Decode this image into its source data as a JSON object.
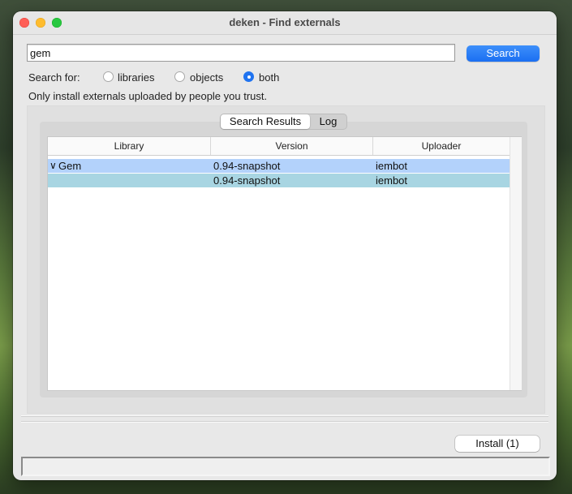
{
  "window": {
    "title": "deken - Find externals"
  },
  "search": {
    "value": "gem",
    "button_label": "Search"
  },
  "search_for": {
    "label": "Search for:",
    "options": [
      "libraries",
      "objects",
      "both"
    ],
    "selected": "both"
  },
  "trust_note": "Only install externals uploaded by people you trust.",
  "tabs": {
    "items": [
      "Search Results",
      "Log"
    ],
    "active": "Search Results"
  },
  "table": {
    "columns": [
      "Library",
      "Version",
      "Uploader"
    ],
    "rows": [
      {
        "library": "Gem",
        "version": "0.94-snapshot",
        "uploader": "iembot",
        "expanded": true
      },
      {
        "library": "",
        "version": "0.94-snapshot",
        "uploader": "iembot"
      }
    ]
  },
  "footer": {
    "install_label": "Install (1)",
    "status_text": ""
  },
  "colors": {
    "accent": "#1f73f0",
    "row_selected_parent": "#b3d2fb",
    "row_selected_child": "#a8d5e2"
  }
}
